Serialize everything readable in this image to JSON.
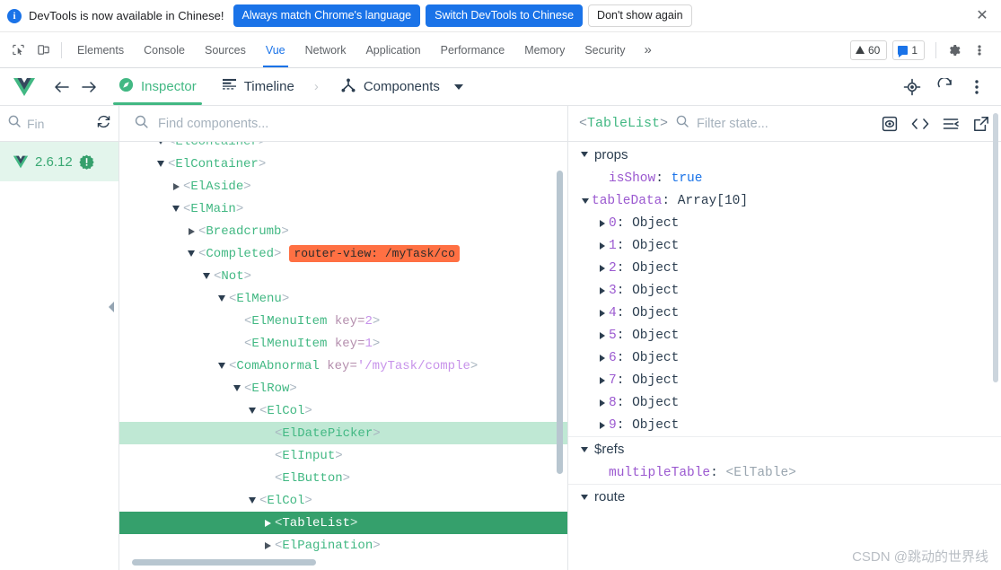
{
  "notification": {
    "icon": "info-icon",
    "message": "DevTools is now available in Chinese!",
    "primary_button": "Always match Chrome's language",
    "secondary_button": "Switch DevTools to Chinese",
    "dismiss_button": "Don't show again",
    "close_icon": "close-icon",
    "accent_color": "#1a73e8"
  },
  "devtools_tabs": {
    "inspect_icon": "inspect-element-icon",
    "device_icon": "device-toolbar-icon",
    "items": [
      {
        "label": "Elements",
        "active": false
      },
      {
        "label": "Console",
        "active": false
      },
      {
        "label": "Sources",
        "active": false
      },
      {
        "label": "Vue",
        "active": true
      },
      {
        "label": "Network",
        "active": false
      },
      {
        "label": "Application",
        "active": false
      },
      {
        "label": "Performance",
        "active": false
      },
      {
        "label": "Memory",
        "active": false
      },
      {
        "label": "Security",
        "active": false
      }
    ],
    "overflow_label": "»",
    "warning_count": "60",
    "message_count": "1",
    "settings_icon": "gear-icon",
    "kebab_icon": "more-vertical-icon",
    "active_color": "#1a73e8"
  },
  "vue_toolbar": {
    "logo": "vue-logo-icon",
    "back_icon": "arrow-left-icon",
    "forward_icon": "arrow-right-icon",
    "tabs": [
      {
        "label": "Inspector",
        "icon": "compass-icon",
        "active": true
      },
      {
        "label": "Timeline",
        "icon": "timeline-icon",
        "active": false
      }
    ],
    "chevron": "›",
    "scope_label": "Components",
    "scope_icon": "components-icon",
    "scope_caret": "chevron-down-icon",
    "target_icon": "select-component-icon",
    "refresh_icon": "refresh-icon",
    "kebab_icon": "more-vertical-icon",
    "accent_color": "#42b883"
  },
  "left_pane": {
    "search_placeholder": "Fin",
    "search_icon": "search-icon",
    "refresh_icon": "refresh-icon",
    "version_logo": "vue-logo-icon",
    "version": "2.6.12",
    "warning_icon": "warning-badge-icon",
    "collapse_icon": "collapse-left-icon",
    "highlight_color": "#e3f5ec"
  },
  "tree_pane": {
    "search_placeholder": "Find components...",
    "search_icon": "search-icon",
    "rows": [
      {
        "indent": 2,
        "arrow": "open",
        "tag": "ElContainer",
        "clipped": true
      },
      {
        "indent": 2,
        "arrow": "open",
        "tag": "ElContainer"
      },
      {
        "indent": 3,
        "arrow": "closed",
        "tag": "ElAside"
      },
      {
        "indent": 3,
        "arrow": "open",
        "tag": "ElMain"
      },
      {
        "indent": 4,
        "arrow": "closed",
        "tag": "Breadcrumb"
      },
      {
        "indent": 4,
        "arrow": "open",
        "tag": "Completed",
        "badge": "router-view: /myTask/co"
      },
      {
        "indent": 5,
        "arrow": "open",
        "tag": "Not"
      },
      {
        "indent": 6,
        "arrow": "open",
        "tag": "ElMenu"
      },
      {
        "indent": 7,
        "arrow": "none",
        "tag": "ElMenuItem",
        "attr_key": "key",
        "attr_val": "2"
      },
      {
        "indent": 7,
        "arrow": "none",
        "tag": "ElMenuItem",
        "attr_key": "key",
        "attr_val": "1"
      },
      {
        "indent": 6,
        "arrow": "open",
        "tag": "ComAbnormal",
        "attr_key": "key",
        "attr_val": "'/myTask/comple"
      },
      {
        "indent": 7,
        "arrow": "open",
        "tag": "ElRow"
      },
      {
        "indent": 8,
        "arrow": "open",
        "tag": "ElCol"
      },
      {
        "indent": 9,
        "arrow": "none",
        "tag": "ElDatePicker",
        "selected": "light"
      },
      {
        "indent": 9,
        "arrow": "none",
        "tag": "ElInput"
      },
      {
        "indent": 9,
        "arrow": "none",
        "tag": "ElButton"
      },
      {
        "indent": 8,
        "arrow": "open",
        "tag": "ElCol"
      },
      {
        "indent": 9,
        "arrow": "closed",
        "tag": "TableList",
        "selected": "strong"
      },
      {
        "indent": 9,
        "arrow": "closed",
        "tag": "ElPagination"
      }
    ],
    "selected_light_color": "#bfe8d4",
    "selected_strong_color": "#35a06c",
    "badge_color": "#ff7043",
    "tag_color": "#42b883",
    "scrollbar_v": "tree-vertical-scrollbar",
    "scrollbar_h": "tree-horizontal-scrollbar"
  },
  "state_pane": {
    "component_name": "TableList",
    "filter_placeholder": "Filter state...",
    "search_icon": "search-icon",
    "icons": [
      "inspect-dom-icon",
      "open-in-editor-icon",
      "collapse-all-icon",
      "open-external-icon"
    ],
    "groups": [
      {
        "name": "props",
        "open": true,
        "rows": [
          {
            "indent": 1,
            "arrow": "none",
            "key": "isShow",
            "value": "true",
            "value_kind": "bool"
          },
          {
            "indent": 0,
            "arrow": "open",
            "key": "tableData",
            "value": "Array[10]",
            "value_kind": "type"
          },
          {
            "indent": 1,
            "arrow": "closed",
            "key": "0",
            "value": "Object",
            "value_kind": "type",
            "key_kind": "index"
          },
          {
            "indent": 1,
            "arrow": "closed",
            "key": "1",
            "value": "Object",
            "value_kind": "type",
            "key_kind": "index"
          },
          {
            "indent": 1,
            "arrow": "closed",
            "key": "2",
            "value": "Object",
            "value_kind": "type",
            "key_kind": "index"
          },
          {
            "indent": 1,
            "arrow": "closed",
            "key": "3",
            "value": "Object",
            "value_kind": "type",
            "key_kind": "index"
          },
          {
            "indent": 1,
            "arrow": "closed",
            "key": "4",
            "value": "Object",
            "value_kind": "type",
            "key_kind": "index"
          },
          {
            "indent": 1,
            "arrow": "closed",
            "key": "5",
            "value": "Object",
            "value_kind": "type",
            "key_kind": "index"
          },
          {
            "indent": 1,
            "arrow": "closed",
            "key": "6",
            "value": "Object",
            "value_kind": "type",
            "key_kind": "index"
          },
          {
            "indent": 1,
            "arrow": "closed",
            "key": "7",
            "value": "Object",
            "value_kind": "type",
            "key_kind": "index"
          },
          {
            "indent": 1,
            "arrow": "closed",
            "key": "8",
            "value": "Object",
            "value_kind": "type",
            "key_kind": "index"
          },
          {
            "indent": 1,
            "arrow": "closed",
            "key": "9",
            "value": "Object",
            "value_kind": "type",
            "key_kind": "index"
          }
        ]
      },
      {
        "name": "$refs",
        "open": true,
        "rows": [
          {
            "indent": 1,
            "arrow": "none",
            "key": "multipleTable",
            "value": "<ElTable>",
            "value_kind": "component"
          }
        ]
      },
      {
        "name": "route",
        "open": true,
        "rows": []
      }
    ],
    "scrollbar_v": "state-vertical-scrollbar"
  },
  "watermark": "CSDN @跳动的世界线"
}
